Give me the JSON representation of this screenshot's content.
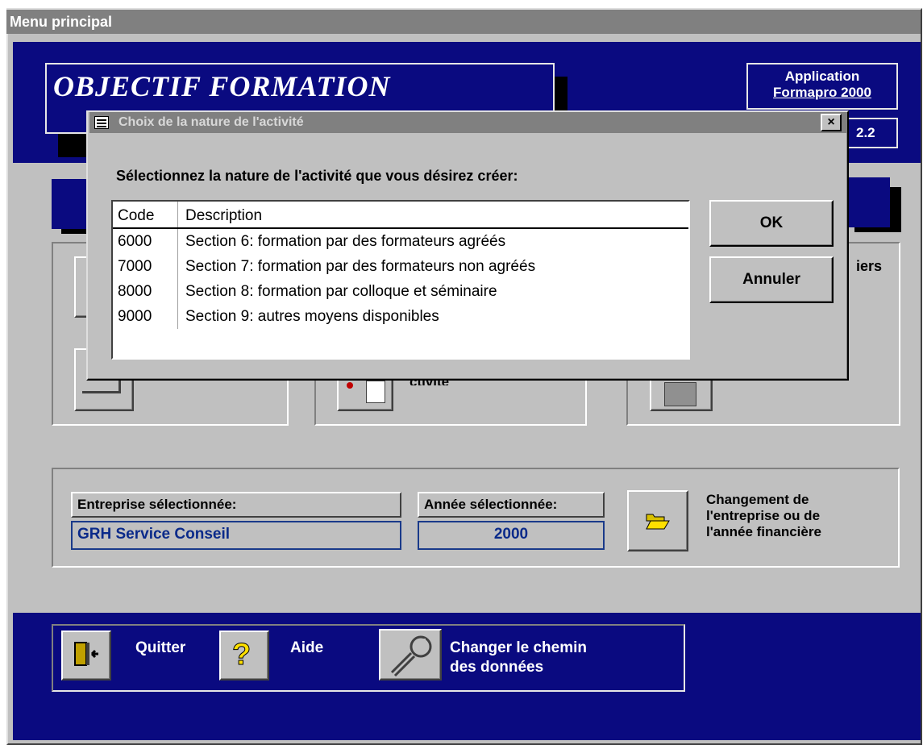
{
  "window": {
    "title": "Menu principal"
  },
  "header": {
    "logo_text": "OBJECTIF  FORMATION",
    "app_line1": "Application",
    "app_line2": "Formapro 2000",
    "version_partial": "2.2"
  },
  "right_group": {
    "partial_label": "iers"
  },
  "middle_group": {
    "partial_label": "ctivité"
  },
  "selection": {
    "company_label": "Entreprise sélectionnée:",
    "company_value": "GRH Service Conseil",
    "year_label": "Année sélectionnée:",
    "year_value": "2000",
    "change_text_1": "Changement de",
    "change_text_2": "l'entreprise ou de",
    "change_text_3": "l'année financière",
    "change_icon": "open-folder-icon"
  },
  "bottom_bar": {
    "quit_label": "Quitter",
    "quit_icon": "exit-door-icon",
    "help_label": "Aide",
    "help_icon": "question-mark-icon",
    "path_label_1": "Changer le chemin",
    "path_label_2": "des données",
    "path_icon": "wrench-icon"
  },
  "dialog": {
    "title": "Choix de la nature de l'activité",
    "close_glyph": "×",
    "prompt": "Sélectionnez la nature de l'activité que vous désirez créer:",
    "columns": [
      "Code",
      "Description"
    ],
    "rows": [
      {
        "code": "6000",
        "description": "Section 6: formation par des formateurs agréés"
      },
      {
        "code": "7000",
        "description": "Section 7: formation par des formateurs non agréés"
      },
      {
        "code": "8000",
        "description": "Section 8: formation par colloque et séminaire"
      },
      {
        "code": "9000",
        "description": "Section 9: autres moyens disponibles"
      }
    ],
    "ok_label": "OK",
    "cancel_label": "Annuler"
  },
  "colors": {
    "navy": "#0a0a80",
    "face": "#c0c0c0",
    "title_inactive": "#808080"
  }
}
